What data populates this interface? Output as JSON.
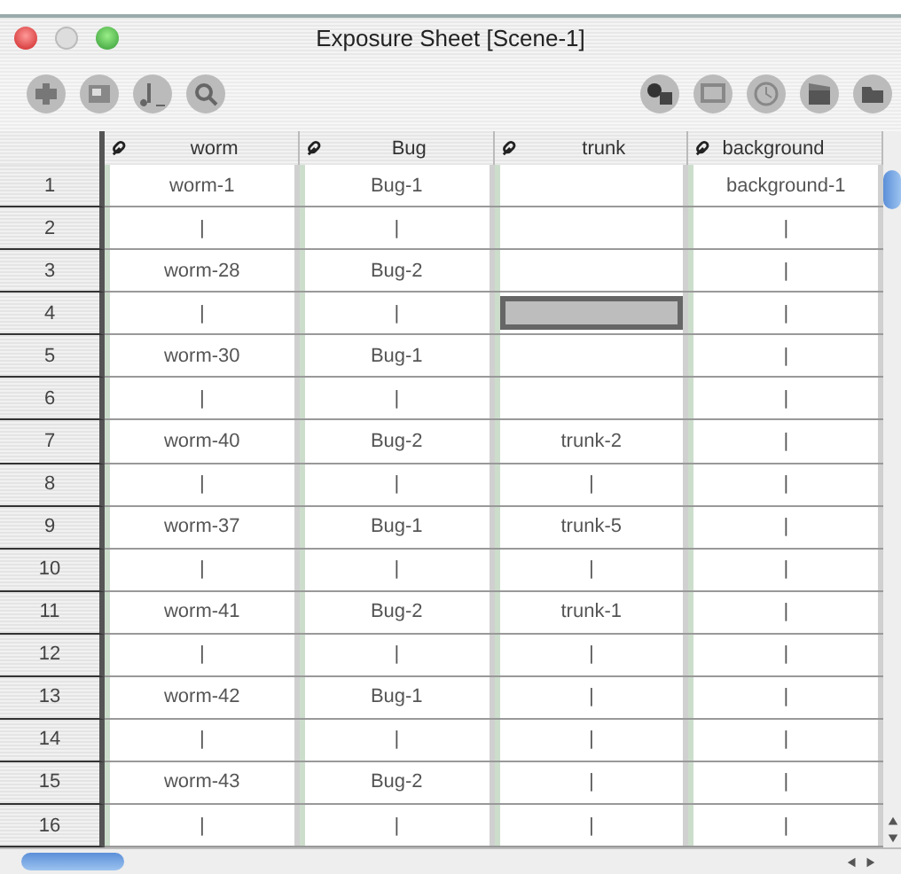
{
  "window": {
    "title": "Exposure Sheet [Scene-1]"
  },
  "columns": [
    "worm",
    "Bug",
    "trunk",
    "background"
  ],
  "rows": [
    {
      "number": "1",
      "cells": [
        {
          "text": "worm-1",
          "selected": false
        },
        {
          "text": "Bug-1",
          "selected": false
        },
        {
          "selected": false
        },
        {
          "text": "background-1",
          "selected": false
        }
      ]
    },
    {
      "number": "2",
      "cells": [
        {
          "text": "|",
          "selected": false
        },
        {
          "text": "|",
          "selected": false
        },
        {
          "selected": false
        },
        {
          "text": "|",
          "selected": false
        }
      ]
    },
    {
      "number": "3",
      "cells": [
        {
          "text": "worm-28",
          "selected": false
        },
        {
          "text": "Bug-2",
          "selected": false
        },
        {
          "selected": false
        },
        {
          "text": "|",
          "selected": false
        }
      ]
    },
    {
      "number": "4",
      "cells": [
        {
          "text": "|",
          "selected": false
        },
        {
          "text": "|",
          "selected": false
        },
        {
          "selected": true
        },
        {
          "text": "|",
          "selected": false
        }
      ]
    },
    {
      "number": "5",
      "cells": [
        {
          "text": "worm-30",
          "selected": false
        },
        {
          "text": "Bug-1",
          "selected": false
        },
        {
          "selected": false
        },
        {
          "text": "|",
          "selected": false
        }
      ]
    },
    {
      "number": "6",
      "cells": [
        {
          "text": "|",
          "selected": false
        },
        {
          "text": "|",
          "selected": false
        },
        {
          "selected": false
        },
        {
          "text": "|",
          "selected": false
        }
      ]
    },
    {
      "number": "7",
      "cells": [
        {
          "text": "worm-40",
          "selected": false
        },
        {
          "text": "Bug-2",
          "selected": false
        },
        {
          "text": "trunk-2",
          "selected": false
        },
        {
          "text": "|",
          "selected": false
        }
      ]
    },
    {
      "number": "8",
      "cells": [
        {
          "text": "|",
          "selected": false
        },
        {
          "text": "|",
          "selected": false
        },
        {
          "text": "|",
          "selected": false
        },
        {
          "text": "|",
          "selected": false
        }
      ]
    },
    {
      "number": "9",
      "cells": [
        {
          "text": "worm-37",
          "selected": false
        },
        {
          "text": "Bug-1",
          "selected": false
        },
        {
          "text": "trunk-5",
          "selected": false
        },
        {
          "text": "|",
          "selected": false
        }
      ]
    },
    {
      "number": "10",
      "cells": [
        {
          "text": "|",
          "selected": false
        },
        {
          "text": "|",
          "selected": false
        },
        {
          "text": "|",
          "selected": false
        },
        {
          "text": "|",
          "selected": false
        }
      ]
    },
    {
      "number": "11",
      "cells": [
        {
          "text": "worm-41",
          "selected": false
        },
        {
          "text": "Bug-2",
          "selected": false
        },
        {
          "text": "trunk-1",
          "selected": false
        },
        {
          "text": "|",
          "selected": false
        }
      ]
    },
    {
      "number": "12",
      "cells": [
        {
          "text": "|",
          "selected": false
        },
        {
          "text": "|",
          "selected": false
        },
        {
          "text": "|",
          "selected": false
        },
        {
          "text": "|",
          "selected": false
        }
      ]
    },
    {
      "number": "13",
      "cells": [
        {
          "text": "worm-42",
          "selected": false
        },
        {
          "text": "Bug-1",
          "selected": false
        },
        {
          "text": "|",
          "selected": false
        },
        {
          "text": "|",
          "selected": false
        }
      ]
    },
    {
      "number": "14",
      "cells": [
        {
          "text": "|",
          "selected": false
        },
        {
          "text": "|",
          "selected": false
        },
        {
          "text": "|",
          "selected": false
        },
        {
          "text": "|",
          "selected": false
        }
      ]
    },
    {
      "number": "15",
      "cells": [
        {
          "text": "worm-43",
          "selected": false
        },
        {
          "text": "Bug-2",
          "selected": false
        },
        {
          "text": "|",
          "selected": false
        },
        {
          "text": "|",
          "selected": false
        }
      ]
    },
    {
      "number": "16",
      "cells": [
        {
          "text": "|",
          "selected": false
        },
        {
          "text": "|",
          "selected": false
        },
        {
          "text": "|",
          "selected": false
        },
        {
          "text": "|",
          "selected": false
        }
      ]
    }
  ]
}
